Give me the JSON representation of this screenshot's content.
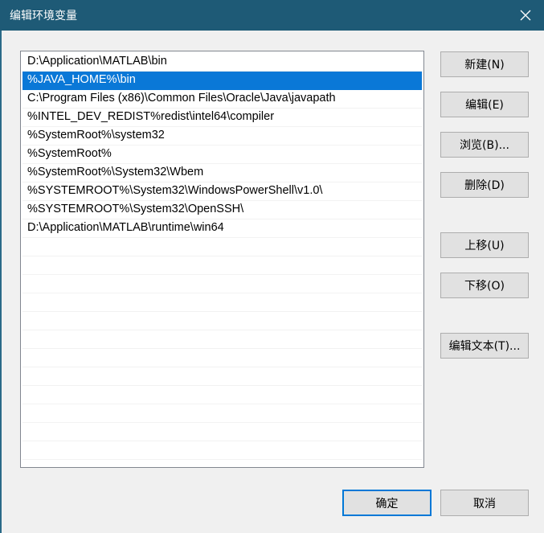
{
  "window": {
    "title": "编辑环境变量",
    "close_icon": "close-icon",
    "accent": "#1e5a76",
    "selection_color": "#0a78d7"
  },
  "list": {
    "items": [
      "D:\\Application\\MATLAB\\bin",
      "%JAVA_HOME%\\bin",
      "C:\\Program Files (x86)\\Common Files\\Oracle\\Java\\javapath",
      "%INTEL_DEV_REDIST%redist\\intel64\\compiler",
      "%SystemRoot%\\system32",
      "%SystemRoot%",
      "%SystemRoot%\\System32\\Wbem",
      "%SYSTEMROOT%\\System32\\WindowsPowerShell\\v1.0\\",
      "%SYSTEMROOT%\\System32\\OpenSSH\\",
      "D:\\Application\\MATLAB\\runtime\\win64"
    ],
    "selected_index": 1
  },
  "buttons": {
    "new": "新建(N)",
    "edit": "编辑(E)",
    "browse": "浏览(B)...",
    "delete": "删除(D)",
    "move_up": "上移(U)",
    "move_down": "下移(O)",
    "edit_text": "编辑文本(T)...",
    "ok": "确定",
    "cancel": "取消"
  }
}
